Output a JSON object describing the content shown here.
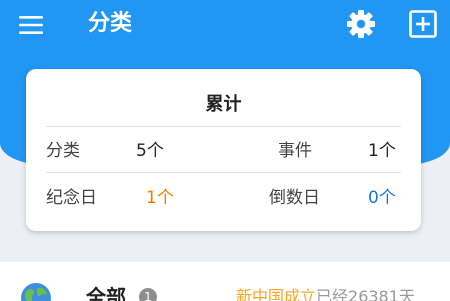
{
  "appbar": {
    "title": "分类",
    "icons": [
      "menu-icon",
      "gear-icon",
      "add-box-icon"
    ]
  },
  "colors": {
    "primary": "#2196f3",
    "accent_orange": "#f57c00",
    "accent_blue": "#1976d2",
    "highlight": "#f5a623"
  },
  "summary": {
    "title": "累计",
    "rows": [
      [
        {
          "label": "分类",
          "value": "5个"
        },
        {
          "label": "事件",
          "value": "1个"
        }
      ],
      [
        {
          "label": "纪念日",
          "value": "1个"
        },
        {
          "label": "倒数日",
          "value": "0个"
        }
      ]
    ]
  },
  "list": {
    "items": [
      {
        "icon": "globe-icon",
        "name": "全部",
        "count": "1",
        "highlight": "新中国成立",
        "detail": "已经26381天"
      }
    ]
  }
}
